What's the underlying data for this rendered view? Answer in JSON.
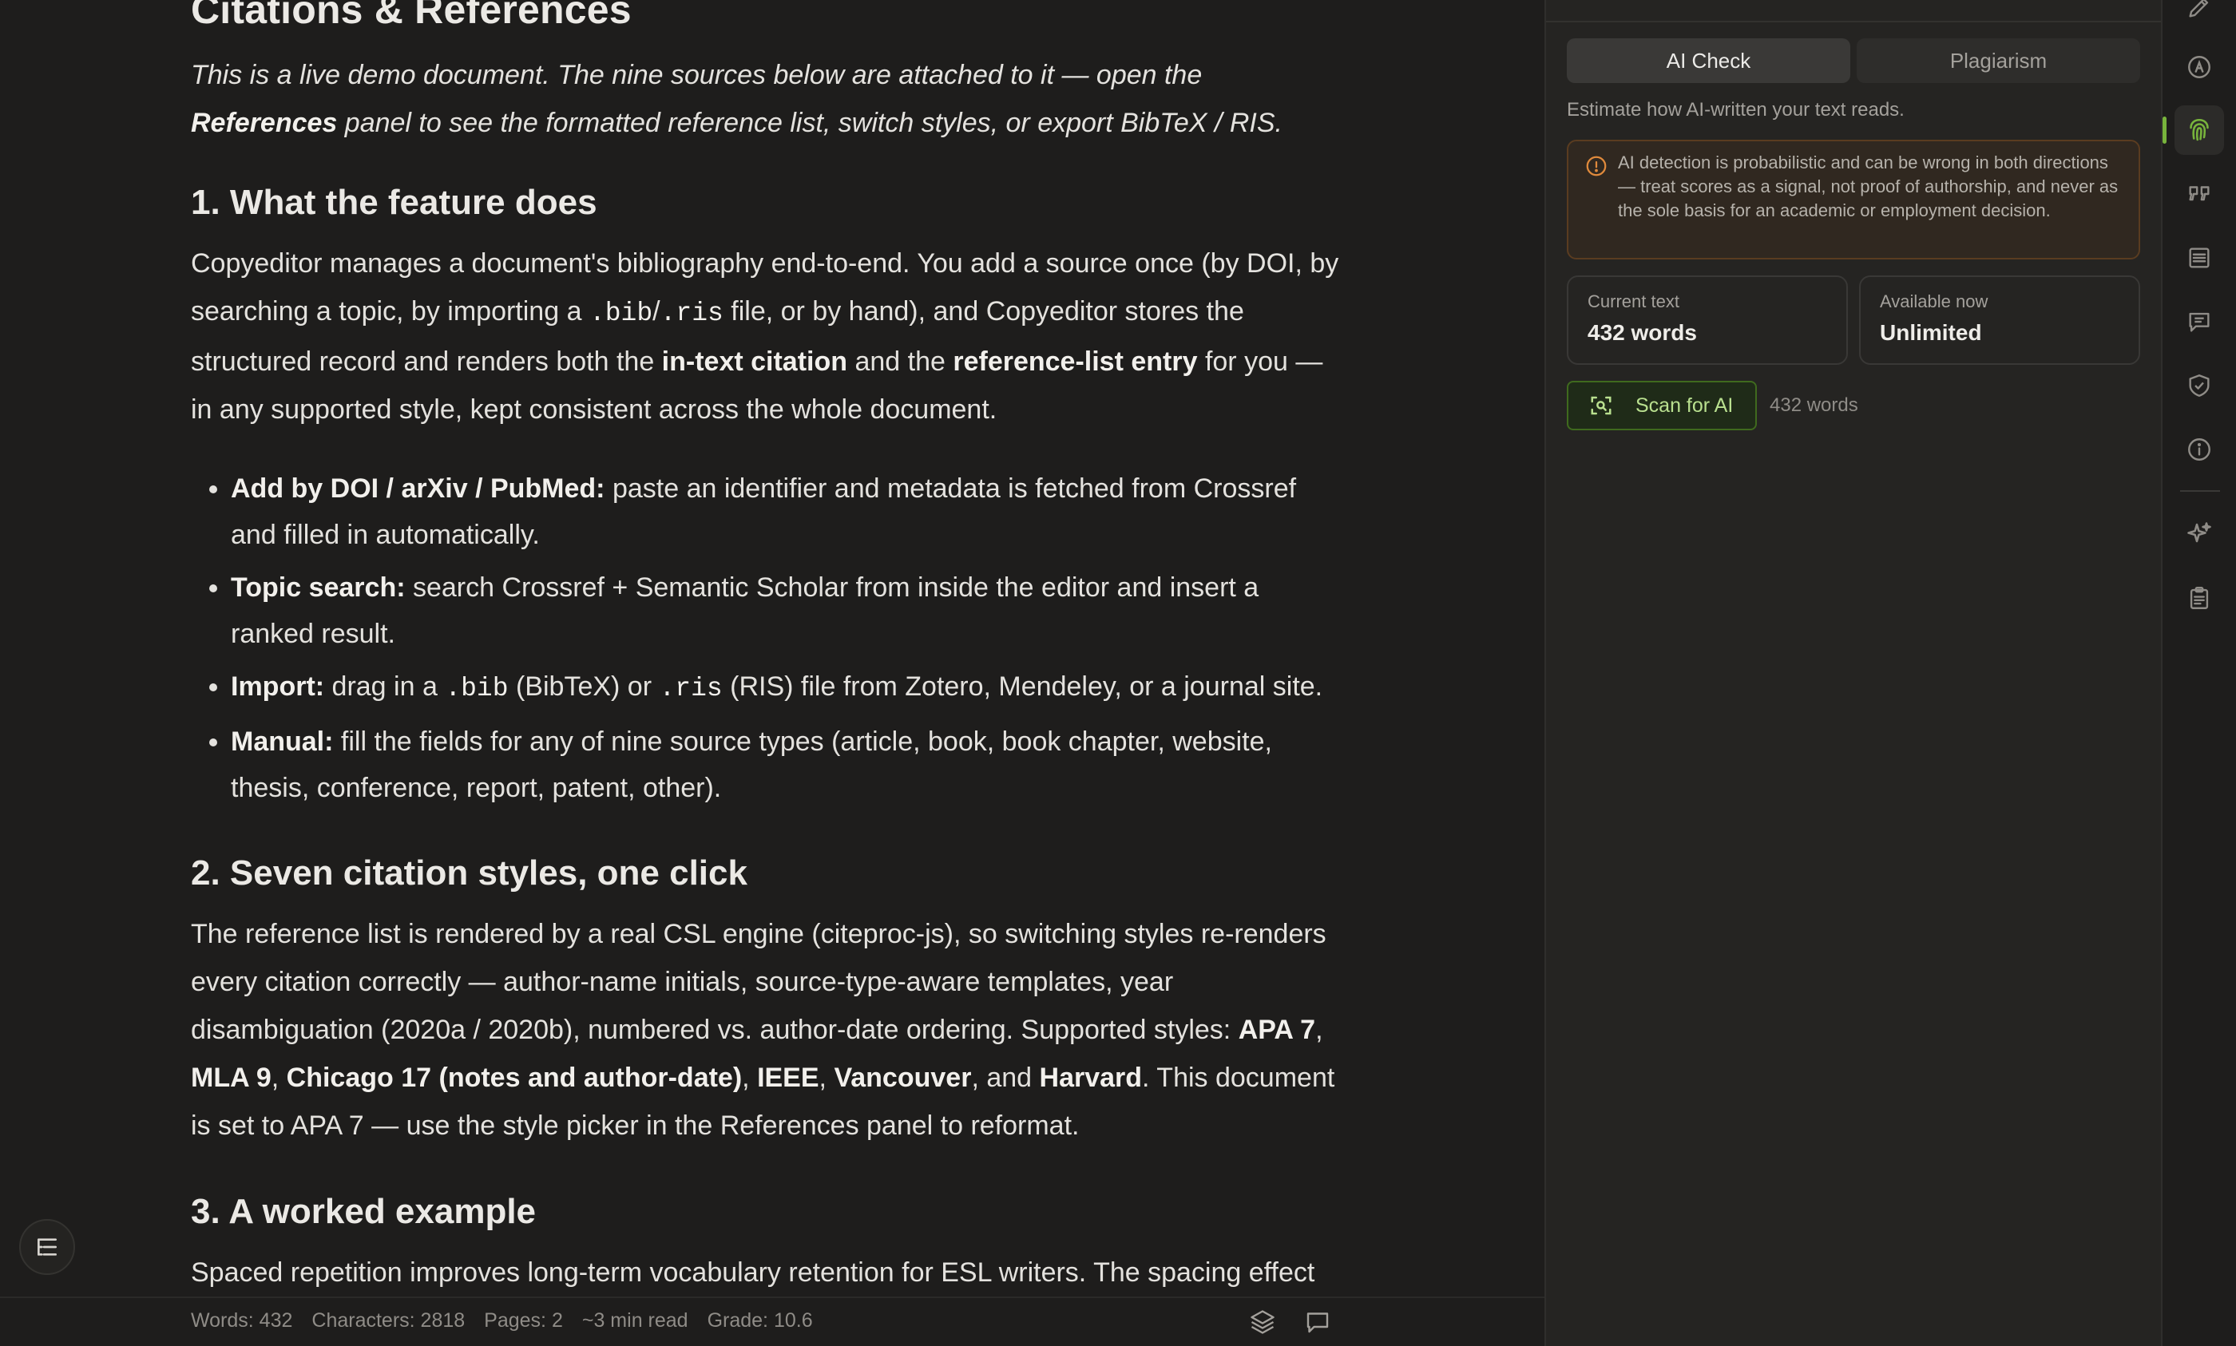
{
  "document": {
    "title": "Citations & References",
    "intro_part1": "This is a live demo document. The nine sources below are attached to it — open the ",
    "intro_bold": "References",
    "intro_part2": " panel to see the formatted reference list, switch styles, or export BibTeX / RIS.",
    "section1": {
      "heading": "1. What the feature does",
      "p1_a": "Copyeditor manages a document's bibliography end-to-end. You add a source once (by DOI, by searching a topic, by importing a ",
      "p1_code1": ".bib",
      "p1_slash": "/",
      "p1_code2": ".ris",
      "p1_b": " file, or by hand), and Copyeditor stores the structured record and renders both the ",
      "p1_bold1": "in-text citation",
      "p1_c": " and the ",
      "p1_bold2": "reference-list entry",
      "p1_d": " for you — in any supported style, kept consistent across the whole document.",
      "bullets": [
        {
          "label": "Add by DOI / arXiv / PubMed:",
          "text": " paste an identifier and metadata is fetched from Crossref and filled in automatically."
        },
        {
          "label": "Topic search:",
          "text": " search Crossref + Semantic Scholar from inside the editor and insert a ranked result."
        },
        {
          "label": "Import:",
          "text_a": " drag in a ",
          "code1": ".bib",
          "text_b": " (BibTeX) or ",
          "code2": ".ris",
          "text_c": " (RIS) file from Zotero, Mendeley, or a journal site."
        },
        {
          "label": "Manual:",
          "text": " fill the fields for any of nine source types (article, book, book chapter, website, thesis, conference, report, patent, other)."
        }
      ]
    },
    "section2": {
      "heading": "2. Seven citation styles, one click",
      "p_a": "The reference list is rendered by a real CSL engine (citeproc-js), so switching styles re-renders every citation correctly — author-name initials, source-type-aware templates, year disambiguation (2020a / 2020b), numbered vs. author-date ordering. Supported styles: ",
      "s1": "APA 7",
      "sep1": ", ",
      "s2": "MLA 9",
      "sep2": ", ",
      "s3": "Chicago 17 (notes and author-date)",
      "sep3": ", ",
      "s4": "IEEE",
      "sep4": ", ",
      "s5": "Vancouver",
      "sep5": ", and ",
      "s6": "Harvard",
      "p_b": ". This document is set to APA 7 — use the style picker in the References panel to reformat."
    },
    "section3": {
      "heading": "3. A worked example",
      "p_partial": "Spaced repetition improves long-term vocabulary retention for ESL writers. The spacing effect"
    }
  },
  "statusbar": {
    "words": "Words: 432",
    "characters": "Characters: 2818",
    "pages": "Pages: 2",
    "read_time": "~3 min read",
    "grade": "Grade: 10.6"
  },
  "panel": {
    "tabs": [
      "AI Check",
      "Plagiarism"
    ],
    "active_tab": "AI Check",
    "description": "Estimate how AI-written your text reads.",
    "warning": "AI detection is probabilistic and can be wrong in both directions — treat scores as a signal, not proof of authorship, and never as the sole basis for an academic or employment decision.",
    "current_text_label": "Current text",
    "current_text_value": "432 words",
    "available_label": "Available now",
    "available_value": "Unlimited",
    "scan_button": "Scan for AI",
    "scan_words": "432 words"
  },
  "rail": {
    "icons": [
      "pen-icon",
      "spellcheck-icon",
      "fingerprint-icon",
      "quote-icon",
      "document-lines-icon",
      "comment-icon",
      "shield-check-icon",
      "info-icon",
      "sparkle-icon",
      "clipboard-icon"
    ],
    "active": "fingerprint-icon"
  },
  "colors": {
    "background": "#1e1d1c",
    "panel": "#252422",
    "accent_green": "#78b43c",
    "warning_orange": "#e08a3c"
  }
}
